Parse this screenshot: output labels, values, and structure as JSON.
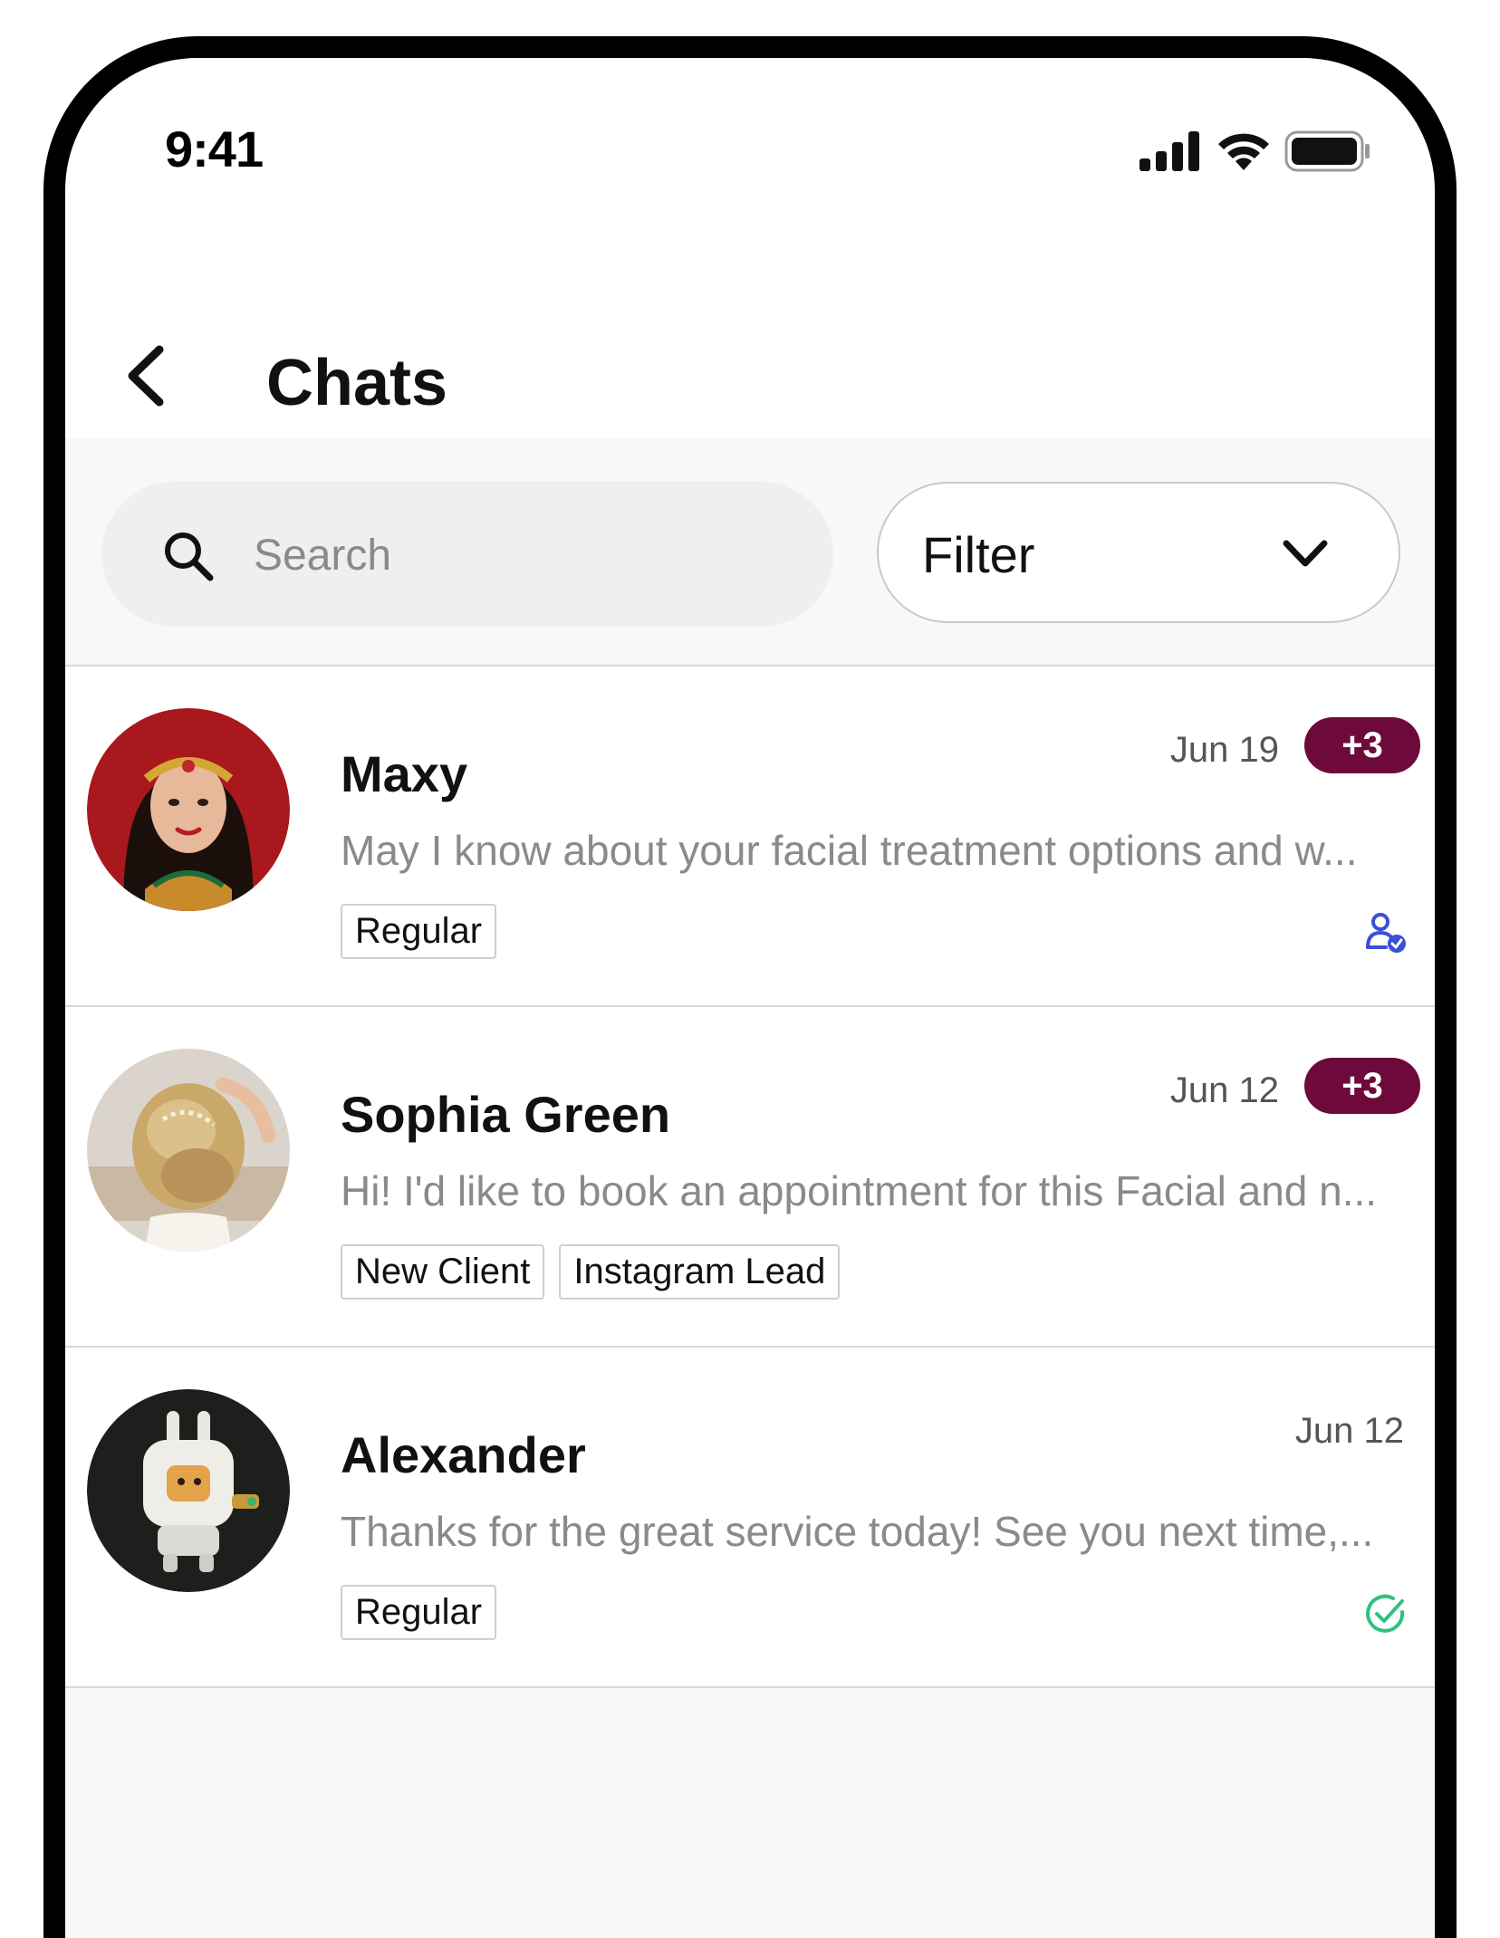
{
  "status_bar": {
    "time": "9:41"
  },
  "header": {
    "title": "Chats"
  },
  "search": {
    "placeholder": "Search",
    "value": ""
  },
  "filter": {
    "label": "Filter"
  },
  "colors": {
    "badge": "#6d0a3b",
    "assigned_icon": "#3b4fd8",
    "read_icon": "#2ec27e"
  },
  "chats": [
    {
      "name": "Maxy",
      "date": "Jun 19",
      "badge": "+3",
      "preview": "May I know about your facial treatment options and w...",
      "tags": [
        "Regular"
      ],
      "status_icon": "user-check-icon"
    },
    {
      "name": "Sophia Green",
      "date": "Jun 12",
      "badge": "+3",
      "preview": "Hi! I'd like to book an appointment for this Facial and n...",
      "tags": [
        "New Client",
        "Instagram Lead"
      ],
      "status_icon": ""
    },
    {
      "name": "Alexander",
      "date": "Jun 12",
      "badge": "",
      "preview": "Thanks for the great service today! See you next time,...",
      "tags": [
        "Regular"
      ],
      "status_icon": "check-circle-icon"
    }
  ]
}
